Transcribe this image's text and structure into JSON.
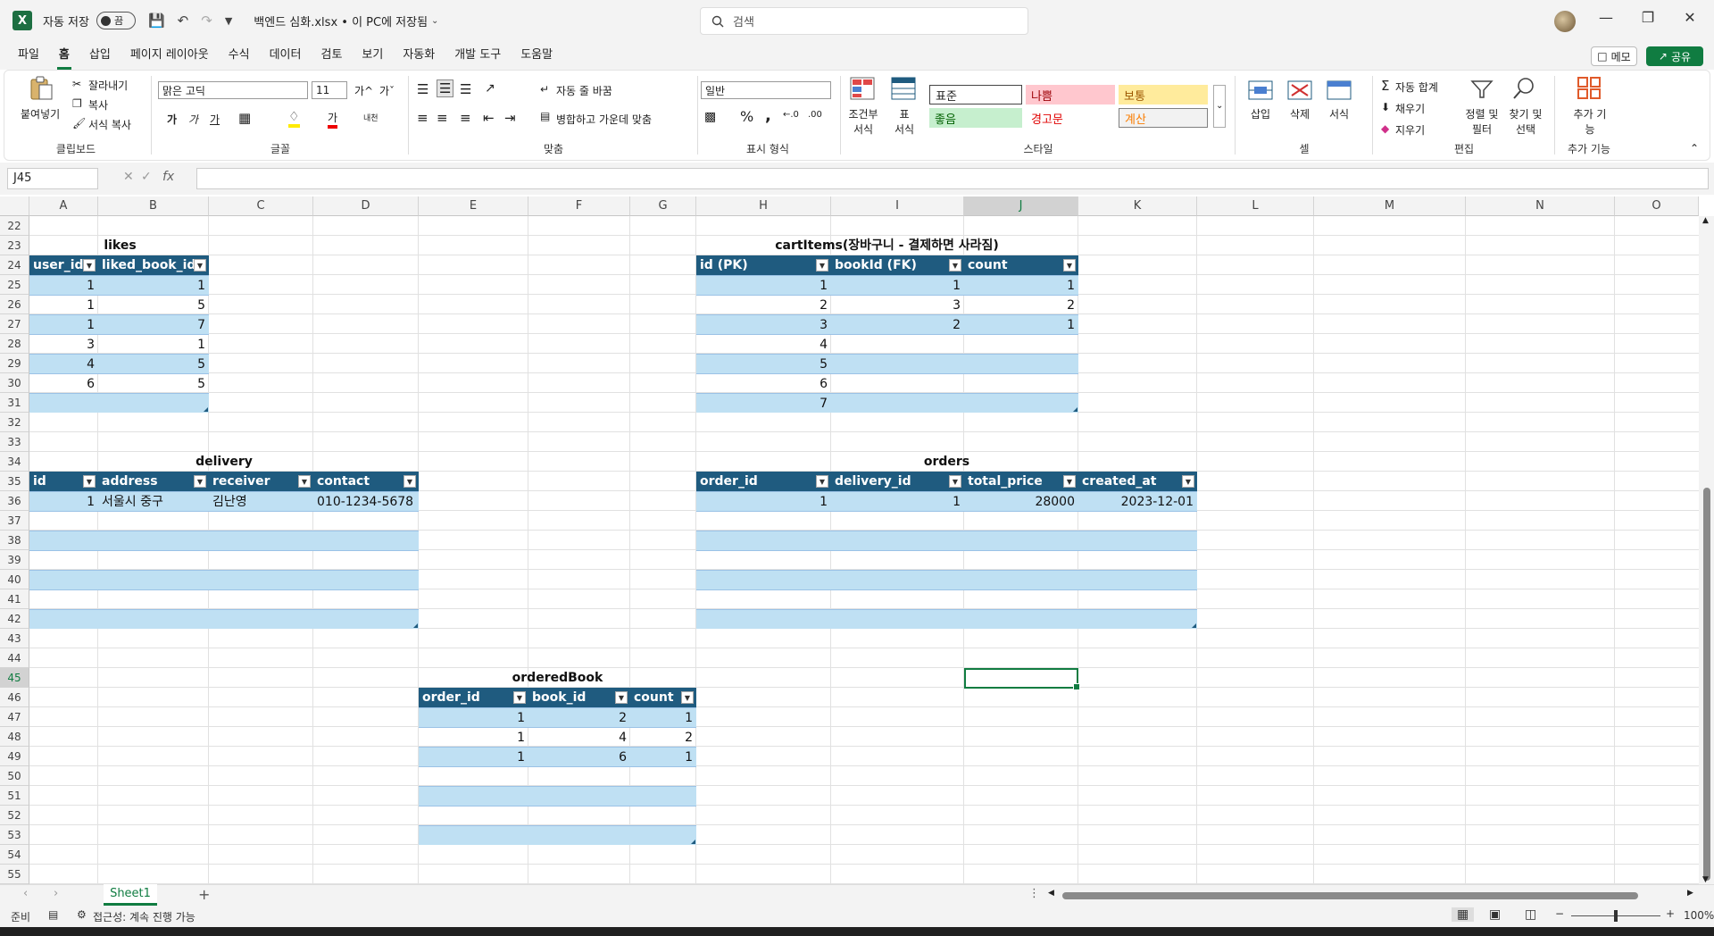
{
  "titlebar": {
    "app_icon": "X",
    "autosave_label": "자동 저장",
    "autosave_state": "끔",
    "filename": "백엔드 심화.xlsx • 이 PC에 저장됨",
    "search_placeholder": "검색"
  },
  "menu": [
    "파일",
    "홈",
    "삽입",
    "페이지 레이아웃",
    "수식",
    "데이터",
    "검토",
    "보기",
    "자동화",
    "개발 도구",
    "도움말"
  ],
  "menu_active": "홈",
  "memo_label": "메모",
  "share_label": "공유",
  "ribbon": {
    "clipboard": {
      "paste": "붙여넣기",
      "cut": "잘라내기",
      "copy": "복사",
      "format_painter": "서식 복사",
      "label": "클립보드"
    },
    "font": {
      "name": "맑은 고딕",
      "size": "11",
      "label": "글꼴",
      "grow": "가^",
      "shrink": "가ˇ",
      "bold": "가",
      "italic": "가",
      "underline": "가",
      "color_letter": "가",
      "phonetic": "내천"
    },
    "alignment": {
      "wrap": "자동 줄 바꿈",
      "merge": "병합하고 가운데 맞춤",
      "label": "맞춤"
    },
    "number": {
      "format": "일반",
      "label": "표시 형식",
      "percent": "%",
      "comma": ","
    },
    "styles": {
      "cond_format": "조건부 서식",
      "table_format": "표 서식",
      "normal": "표준",
      "bad": "나쁨",
      "neutral": "보통",
      "good": "좋음",
      "warning": "경고문",
      "calc": "계산",
      "label": "스타일"
    },
    "cells": {
      "insert": "삽입",
      "delete": "삭제",
      "format": "서식",
      "label": "셀"
    },
    "editing": {
      "autosum": "자동 합계",
      "fill": "채우기",
      "clear": "지우기",
      "sort": "정렬 및 필터",
      "find": "찾기 및 선택",
      "label": "편집"
    },
    "addins": {
      "addins": "추가 기능",
      "label": "추가 기능"
    }
  },
  "namebox": "J45",
  "fx": "fx",
  "columns": [
    "A",
    "B",
    "C",
    "D",
    "E",
    "F",
    "G",
    "H",
    "I",
    "J",
    "K",
    "L",
    "M",
    "N",
    "O"
  ],
  "rows": [
    "22",
    "23",
    "24",
    "25",
    "26",
    "27",
    "28",
    "29",
    "30",
    "31",
    "32",
    "33",
    "34",
    "35",
    "36",
    "37",
    "38",
    "39",
    "40",
    "41",
    "42",
    "43",
    "44",
    "45",
    "46",
    "47",
    "48",
    "49",
    "50",
    "51",
    "52",
    "53",
    "54",
    "55"
  ],
  "tables": {
    "likes": {
      "title": "likes",
      "headers": [
        "user_id",
        "liked_book_id"
      ],
      "rows": [
        [
          "1",
          "1"
        ],
        [
          "1",
          "5"
        ],
        [
          "1",
          "7"
        ],
        [
          "3",
          "1"
        ],
        [
          "4",
          "5"
        ],
        [
          "6",
          "5"
        ],
        [
          "",
          ""
        ]
      ]
    },
    "cartItems": {
      "title": "cartItems(장바구니 - 결제하면 사라짐)",
      "headers": [
        "id (PK)",
        "bookId (FK)",
        "count"
      ],
      "rows": [
        [
          "1",
          "1",
          "1"
        ],
        [
          "2",
          "3",
          "2"
        ],
        [
          "3",
          "2",
          "1"
        ],
        [
          "4",
          "",
          ""
        ],
        [
          "5",
          "",
          ""
        ],
        [
          "6",
          "",
          ""
        ],
        [
          "7",
          "",
          ""
        ]
      ]
    },
    "delivery": {
      "title": "delivery",
      "headers": [
        "id",
        "address",
        "receiver",
        "contact"
      ],
      "rows": [
        [
          "1",
          "서울시 중구",
          "김난영",
          "010-1234-5678"
        ],
        [
          "",
          "",
          "",
          ""
        ],
        [
          "",
          "",
          "",
          ""
        ],
        [
          "",
          "",
          "",
          ""
        ],
        [
          "",
          "",
          "",
          ""
        ],
        [
          "",
          "",
          "",
          ""
        ],
        [
          "",
          "",
          "",
          ""
        ]
      ]
    },
    "orders": {
      "title": "orders",
      "headers": [
        "order_id",
        "delivery_id",
        "total_price",
        "created_at"
      ],
      "rows": [
        [
          "1",
          "1",
          "28000",
          "2023-12-01"
        ],
        [
          "",
          "",
          "",
          ""
        ],
        [
          "",
          "",
          "",
          ""
        ],
        [
          "",
          "",
          "",
          ""
        ],
        [
          "",
          "",
          "",
          ""
        ],
        [
          "",
          "",
          "",
          ""
        ],
        [
          "",
          "",
          "",
          ""
        ]
      ]
    },
    "orderedBook": {
      "title": "orderedBook",
      "headers": [
        "order_id",
        "book_id",
        "count"
      ],
      "rows": [
        [
          "1",
          "2",
          "1"
        ],
        [
          "1",
          "4",
          "2"
        ],
        [
          "1",
          "6",
          "1"
        ],
        [
          "",
          "",
          ""
        ],
        [
          "",
          "",
          ""
        ],
        [
          "",
          "",
          ""
        ],
        [
          "",
          "",
          ""
        ]
      ]
    }
  },
  "sheet_tab": "Sheet1",
  "status": {
    "ready": "준비",
    "accessibility": "접근성: 계속 진행 가능",
    "zoom": "100%"
  },
  "colors": {
    "accent": "#107c41",
    "table_header": "#1f5b7f",
    "table_band": "#bfe0f3"
  }
}
